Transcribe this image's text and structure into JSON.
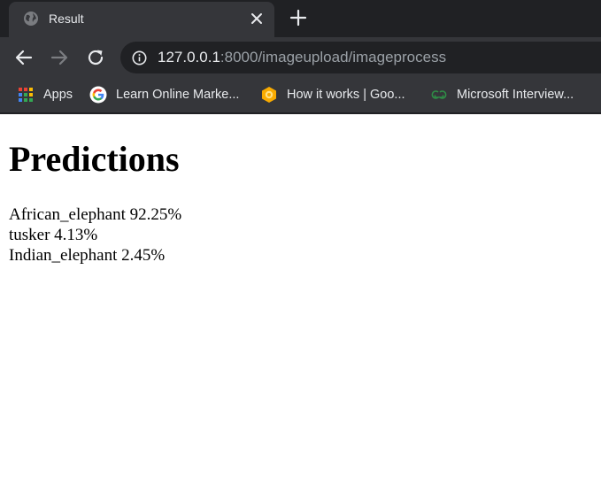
{
  "tab": {
    "title": "Result",
    "favicon": "globe-icon"
  },
  "toolbar": {
    "back_icon": "back-arrow-icon",
    "forward_icon": "forward-arrow-icon",
    "reload_icon": "reload-icon",
    "site_info_icon": "info-icon",
    "url_host": "127.0.0.1",
    "url_rest": ":8000/imageupload/imageprocess"
  },
  "bookmarks": [
    {
      "label": "Apps",
      "icon": "apps-grid-icon"
    },
    {
      "label": "Learn Online Marke...",
      "icon": "google-icon"
    },
    {
      "label": "How it works | Goo...",
      "icon": "hexagon-logo-icon"
    },
    {
      "label": "Microsoft Interview...",
      "icon": "gfg-icon"
    }
  ],
  "page": {
    "heading": "Predictions",
    "predictions": [
      {
        "text": "African_elephant 92.25%"
      },
      {
        "text": "tusker 4.13%"
      },
      {
        "text": "Indian_elephant 2.45%"
      }
    ]
  },
  "colors": {
    "chrome_dark": "#202124",
    "chrome_tab": "#35363a",
    "chrome_text": "#e8eaed",
    "url_muted": "#9aa0a6"
  }
}
